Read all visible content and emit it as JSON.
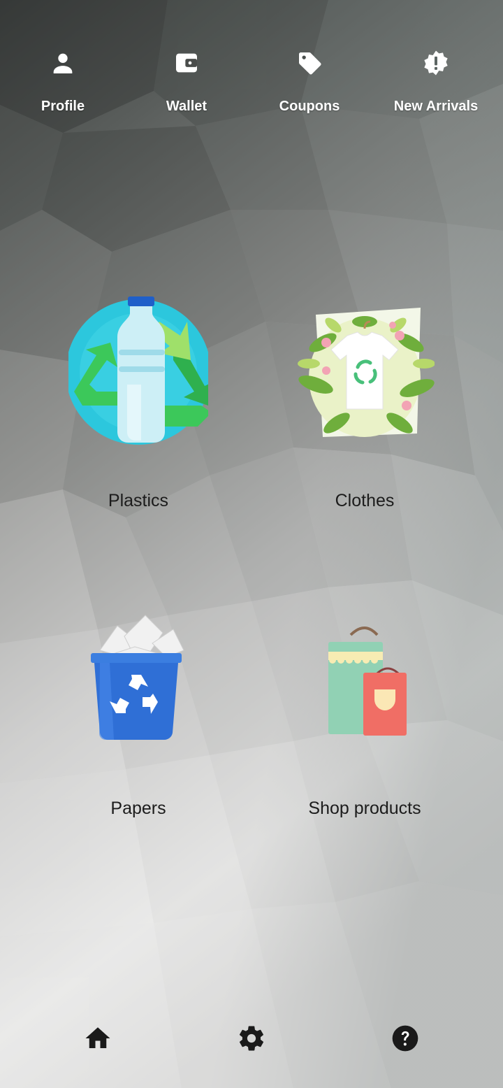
{
  "top_nav": {
    "items": [
      {
        "label": "Profile",
        "icon": "person-icon"
      },
      {
        "label": "Wallet",
        "icon": "wallet-icon"
      },
      {
        "label": "Coupons",
        "icon": "tag-icon"
      },
      {
        "label": "New Arrivals",
        "icon": "new-releases-icon"
      }
    ]
  },
  "categories": [
    {
      "label": "Plastics",
      "icon": "plastic-bottle-recycle-icon"
    },
    {
      "label": "Clothes",
      "icon": "tshirt-recycle-icon"
    },
    {
      "label": "Papers",
      "icon": "paper-recycle-bin-icon"
    },
    {
      "label": "Shop products",
      "icon": "shopping-bags-icon"
    }
  ],
  "bottom_nav": {
    "items": [
      {
        "icon": "home-icon"
      },
      {
        "icon": "settings-icon"
      },
      {
        "icon": "help-icon"
      }
    ]
  },
  "colors": {
    "top_text": "#ffffff",
    "label_text": "#1c1c1c",
    "bottom_icons": "#1a1a1a",
    "recycle_green": "#3cc85a",
    "bin_blue": "#2f6fd6"
  }
}
